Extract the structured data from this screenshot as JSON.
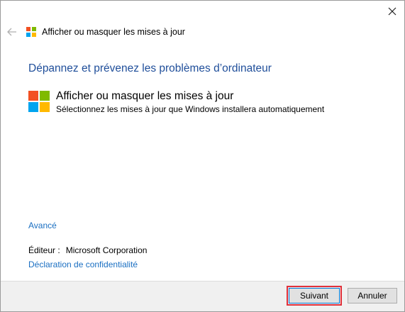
{
  "window": {
    "close_glyph": "✕"
  },
  "header": {
    "back_glyph": "←",
    "title": "Afficher ou masquer les mises à jour"
  },
  "main": {
    "heading": "Dépannez et prévenez les problèmes d’ordinateur",
    "item": {
      "title": "Afficher ou masquer les mises à jour",
      "description": "Sélectionnez les mises à jour que Windows installera automatiquement"
    },
    "advanced_link": "Avancé",
    "publisher_label": "Éditeur :",
    "publisher_value": "Microsoft Corporation",
    "privacy_link": "Déclaration de confidentialité"
  },
  "footer": {
    "next_label": "Suivant",
    "cancel_label": "Annuler"
  },
  "colors": {
    "heading": "#1f4e9a",
    "link": "#1a6fc2",
    "highlight": "#e0303a",
    "logo_red": "#f25022",
    "logo_green": "#7fba00",
    "logo_blue": "#00a4ef",
    "logo_yellow": "#ffb900"
  },
  "icons": {
    "close": "close-icon",
    "back": "back-arrow-icon",
    "logo": "windows-logo-icon"
  }
}
